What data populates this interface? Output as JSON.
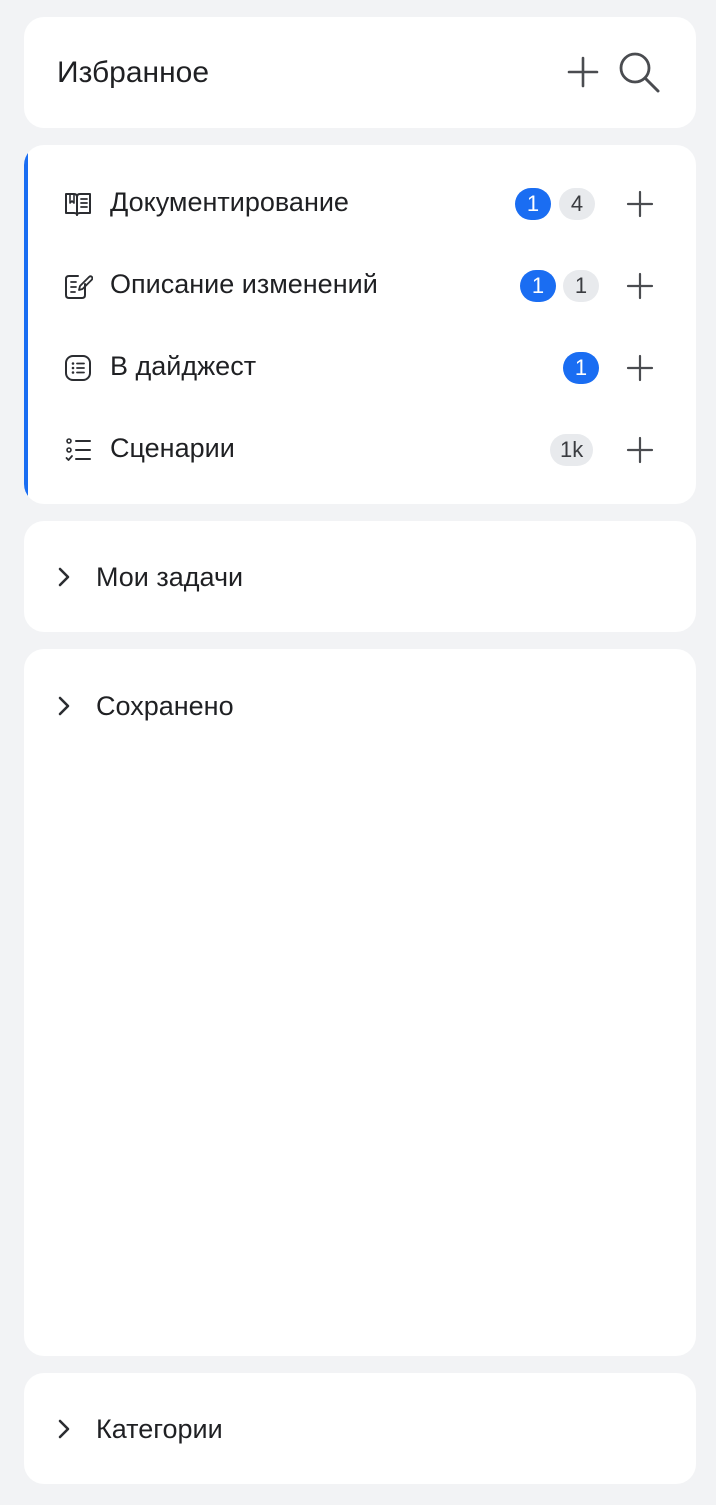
{
  "header": {
    "title": "Избранное"
  },
  "favorites": {
    "items": [
      {
        "label": "Документирование",
        "icon": "book-icon",
        "badges": [
          {
            "value": "1",
            "kind": "blue"
          },
          {
            "value": "4",
            "kind": "gray"
          }
        ]
      },
      {
        "label": "Описание изменений",
        "icon": "edit-note-icon",
        "badges": [
          {
            "value": "1",
            "kind": "blue"
          },
          {
            "value": "1",
            "kind": "gray"
          }
        ]
      },
      {
        "label": "В дайджест",
        "icon": "list-box-icon",
        "badges": [
          {
            "value": "1",
            "kind": "blue"
          }
        ]
      },
      {
        "label": "Сценарии",
        "icon": "checklist-icon",
        "badges": [
          {
            "value": "1k",
            "kind": "gray"
          }
        ]
      }
    ]
  },
  "sections": {
    "tasks": {
      "label": "Мои задачи"
    },
    "saved": {
      "label": "Сохранено"
    },
    "categories": {
      "label": "Категории"
    }
  },
  "colors": {
    "accent": "#1a6df2",
    "background": "#f2f3f5",
    "card": "#ffffff",
    "badge_gray": "#e8eaed"
  },
  "icons": {
    "add": "plus-icon",
    "search": "search-icon",
    "chevron": "chevron-right-icon"
  }
}
